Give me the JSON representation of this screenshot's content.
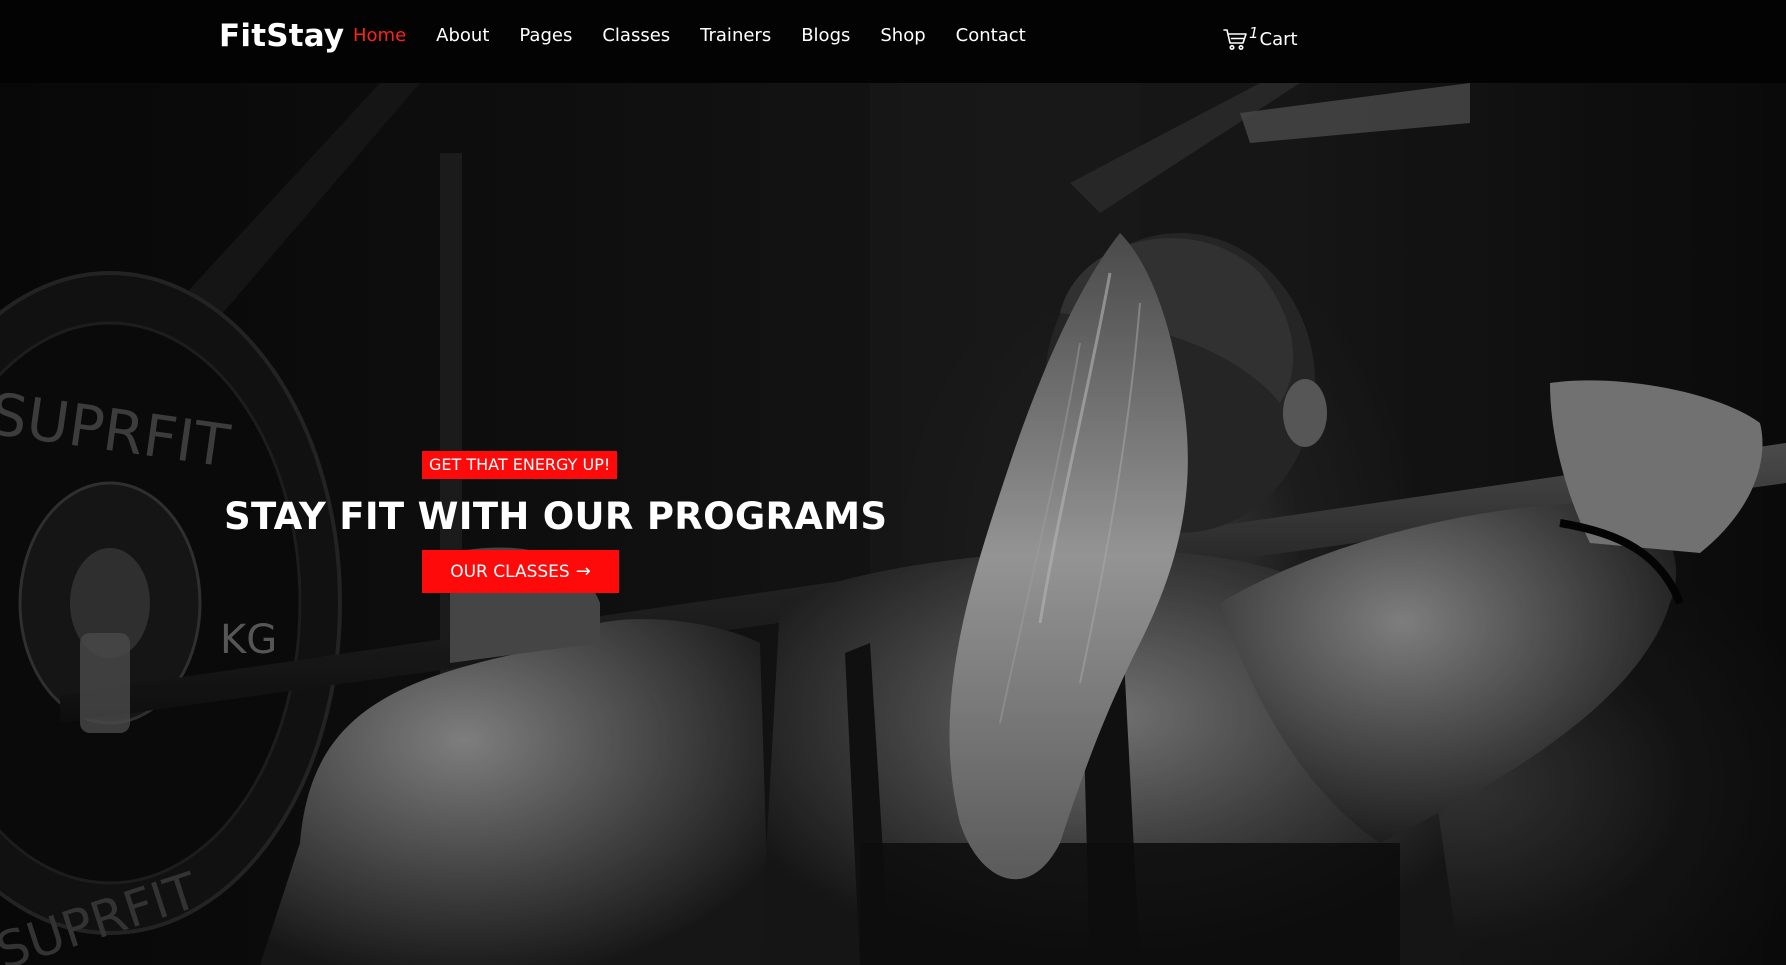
{
  "header": {
    "logo": "FitStay",
    "nav": [
      {
        "label": "Home",
        "active": true
      },
      {
        "label": "About"
      },
      {
        "label": "Pages"
      },
      {
        "label": "Classes"
      },
      {
        "label": "Trainers"
      },
      {
        "label": "Blogs"
      },
      {
        "label": "Shop"
      },
      {
        "label": "Contact"
      }
    ],
    "cart": {
      "count": "1",
      "label": "Cart",
      "icon": "cart-icon"
    }
  },
  "hero": {
    "tagline": "GET THAT ENERGY UP!",
    "headline": "STAY FIT WITH OUR PROGRAMS",
    "cta_label": "OUR CLASSES",
    "cta_icon": "arrow-right-icon",
    "plate_text_top": "SUPRFIT",
    "plate_text_kg": "KG",
    "plate_text_bottom": "SUPRFIT"
  },
  "colors": {
    "accent": "#ff0a0a",
    "active_nav": "#ff2020",
    "header_bg": "#030303",
    "text": "#ffffff"
  }
}
